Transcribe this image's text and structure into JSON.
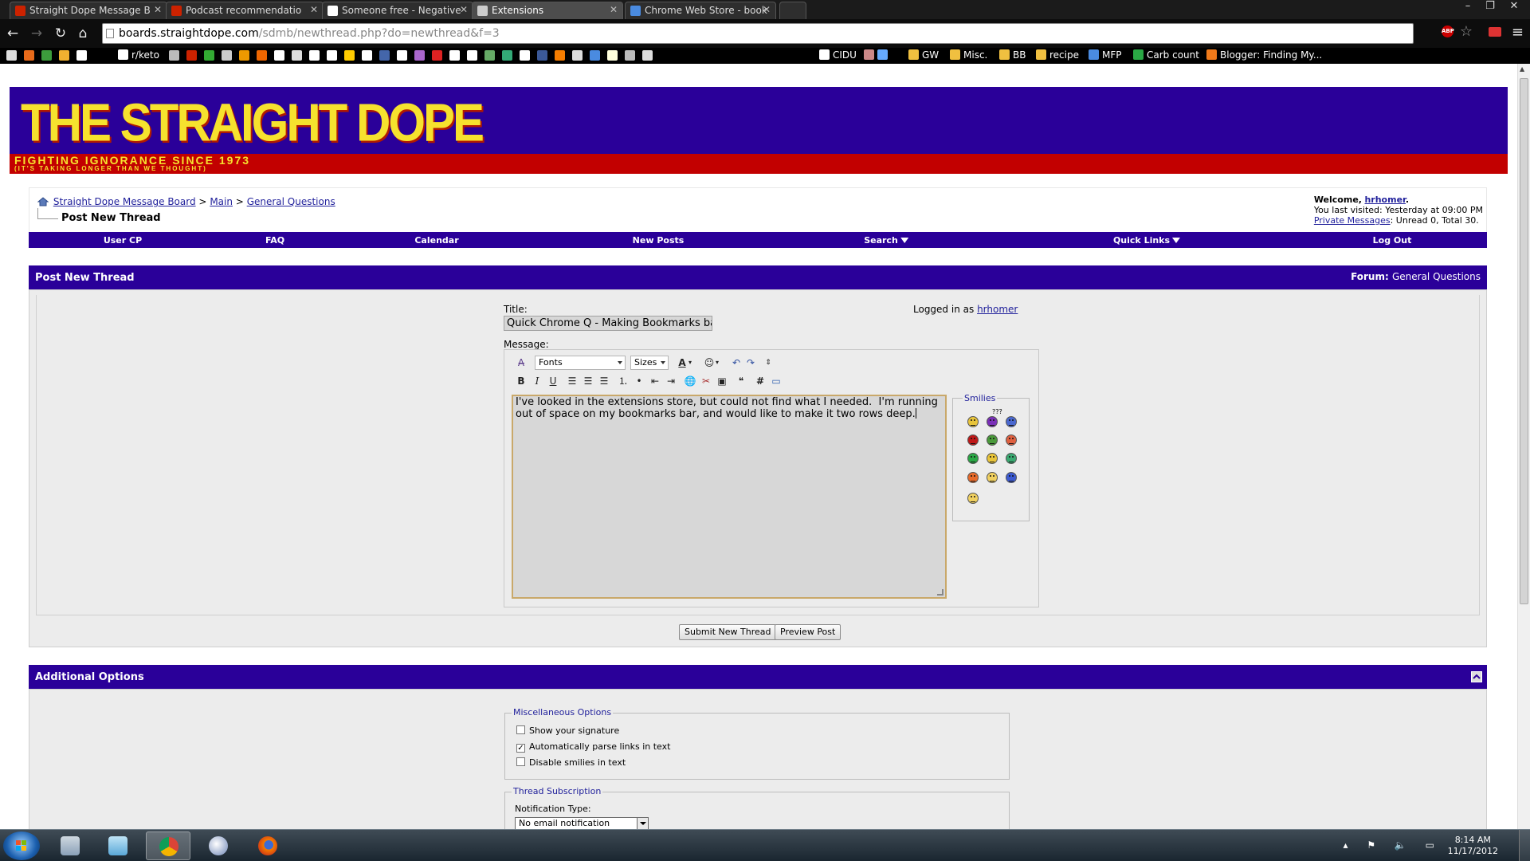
{
  "browser": {
    "tabs": [
      {
        "label": "Straight Dope Message B",
        "favicon_color": "#cc2200"
      },
      {
        "label": "Podcast recommendatio",
        "favicon_color": "#cc2200"
      },
      {
        "label": "Someone free - Negative",
        "favicon_color": "#ffffff"
      },
      {
        "label": "Extensions",
        "favicon_color": "#cccccc"
      },
      {
        "label": "Chrome Web Store - book",
        "favicon_color": "#4a8be0"
      }
    ],
    "url_host": "boards.straightdope.com",
    "url_path": "/sdmb/newthread.php?do=newthread&f=3",
    "abp_label": "ABP",
    "bookmarks": [
      {
        "label": "r/keto",
        "color": "#ffffff"
      },
      {
        "label": "CIDU",
        "color": "#ffffff"
      },
      {
        "label": "GW",
        "color": "#f0c040"
      },
      {
        "label": "Misc.",
        "color": "#f0c040"
      },
      {
        "label": "BB",
        "color": "#f0c040"
      },
      {
        "label": "recipe",
        "color": "#f0c040"
      },
      {
        "label": "MFP",
        "color": "#4a8be0"
      },
      {
        "label": "Carb count",
        "color": "#2aa845"
      },
      {
        "label": "Blogger: Finding My...",
        "color": "#f07a1a"
      }
    ]
  },
  "site": {
    "logo_title": "THE STRAIGHT DOPE",
    "logo_tagline": "FIGHTING IGNORANCE SINCE 1973",
    "logo_subtagline": "(IT'S TAKING LONGER THAN WE THOUGHT)"
  },
  "breadcrumb": {
    "items": [
      "Straight Dope Message Board",
      "Main",
      "General Questions"
    ],
    "separator": ">",
    "current": "Post New Thread"
  },
  "welcome": {
    "prefix": "Welcome,",
    "username": "hrhomer",
    "suffix": ".",
    "last_visited": "You last visited: Yesterday at 09:00 PM",
    "pm_link": "Private Messages",
    "pm_counts": ": Unread 0, Total 30."
  },
  "navbar": {
    "items": [
      "User CP",
      "FAQ",
      "Calendar",
      "New Posts",
      "Search",
      "Quick Links",
      "Log Out"
    ]
  },
  "post_panel": {
    "title": "Post New Thread",
    "forum_label": "Forum:",
    "forum_name": "General Questions",
    "title_label": "Title:",
    "title_value": "Quick Chrome Q - Making Bookmarks bar",
    "logged_in_prefix": "Logged in as",
    "logged_in_user": "hrhomer",
    "message_label": "Message:",
    "fonts_label": "Fonts",
    "sizes_label": "Sizes",
    "message_text": "I've looked in the extensions store, but could not find what I needed.  I'm running out of space on my bookmarks bar, and would like to make it two rows deep.",
    "smilies_label": "Smilies",
    "smilies_extra_label": "???",
    "submit_label": "Submit New Thread",
    "preview_label": "Preview Post"
  },
  "additional_options": {
    "title": "Additional Options",
    "misc_legend": "Miscellaneous Options",
    "options": [
      {
        "label": "Show your signature",
        "checked": false
      },
      {
        "label": "Automatically parse links in text",
        "checked": true
      },
      {
        "label": "Disable smilies in text",
        "checked": false
      }
    ],
    "subscription_legend": "Thread Subscription",
    "notification_label": "Notification Type:",
    "notification_value": "No email notification"
  },
  "taskbar": {
    "time": "8:14 AM",
    "date": "11/17/2012"
  },
  "colors": {
    "header_purple": "#2a0099",
    "banner_red": "#c20000",
    "logo_yellow": "#f6e22e",
    "link_blue": "#22229c"
  }
}
